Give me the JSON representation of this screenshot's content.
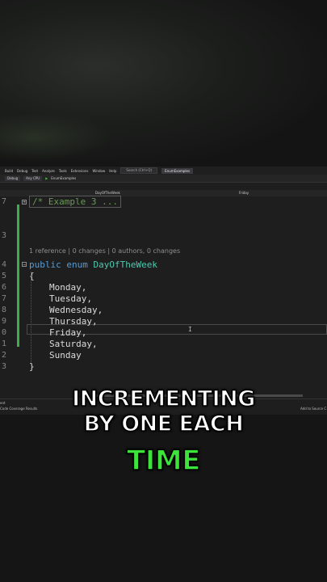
{
  "menu": {
    "items": [
      "Build",
      "Debug",
      "Test",
      "Analyze",
      "Tools",
      "Extensions",
      "Window",
      "Help"
    ],
    "search_placeholder": "Search (Ctrl+Q)",
    "solution_name": "EnumExamples"
  },
  "toolbar": {
    "config": "Debug",
    "platform": "Any CPU",
    "run_target": "EnumExamples"
  },
  "nav": {
    "type_dropdown": "DayOfTheWeek",
    "member_dropdown": "Friday"
  },
  "editor": {
    "line_numbers": [
      "7",
      "3",
      "4",
      "5",
      "6",
      "7",
      "8",
      "9",
      "0",
      "1",
      "2",
      "3"
    ],
    "collapsed_region": "/* Example 3 ...",
    "codelens": "1 reference | 0 changes | 0 authors, 0 changes",
    "decl_keyword1": "public",
    "decl_keyword2": "enum",
    "decl_type": "DayOfTheWeek",
    "open_brace": "{",
    "close_brace": "}",
    "members": [
      "Monday,",
      "Tuesday,",
      "Wednesday,",
      "Thursday,",
      "Friday,",
      "Saturday,",
      "Sunday"
    ]
  },
  "statusbar": {
    "left": "ent",
    "left2": "Code Coverage Results",
    "right": "Add to Source C"
  },
  "caption": {
    "line1": "INCREMENTING",
    "line2": "BY ONE EACH",
    "line3": "TIME"
  },
  "colors": {
    "caption_accent": "#3ce33a",
    "keyword": "#569cd6",
    "type": "#4ec9b0",
    "change_bar": "#3fae49"
  }
}
